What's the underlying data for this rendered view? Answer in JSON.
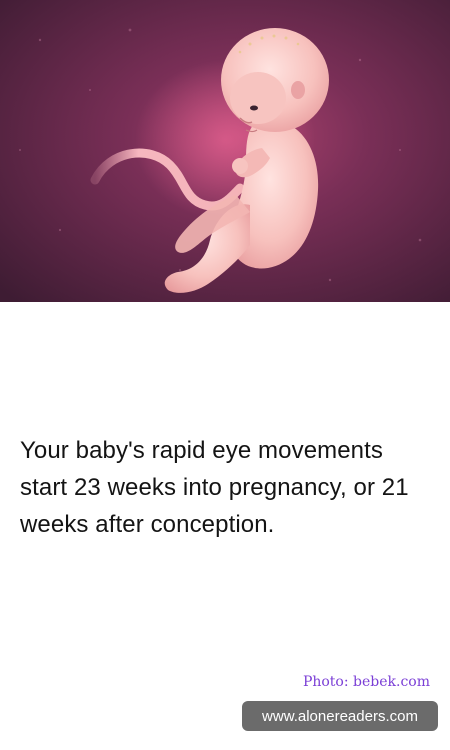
{
  "hero": {
    "image_subject": "fetus-illustration"
  },
  "fact": {
    "text": "Your baby's rapid eye movements start 23 weeks into pregnancy, or 21 weeks after conception."
  },
  "credit": {
    "text": "Photo: bebek.com"
  },
  "watermark": {
    "text": "www.alonereaders.com"
  },
  "colors": {
    "background": "#ffffff",
    "hero_background": "#5a2444",
    "text": "#141414",
    "credit": "#7b3fd6",
    "watermark_bg": "#6b6b6b"
  }
}
